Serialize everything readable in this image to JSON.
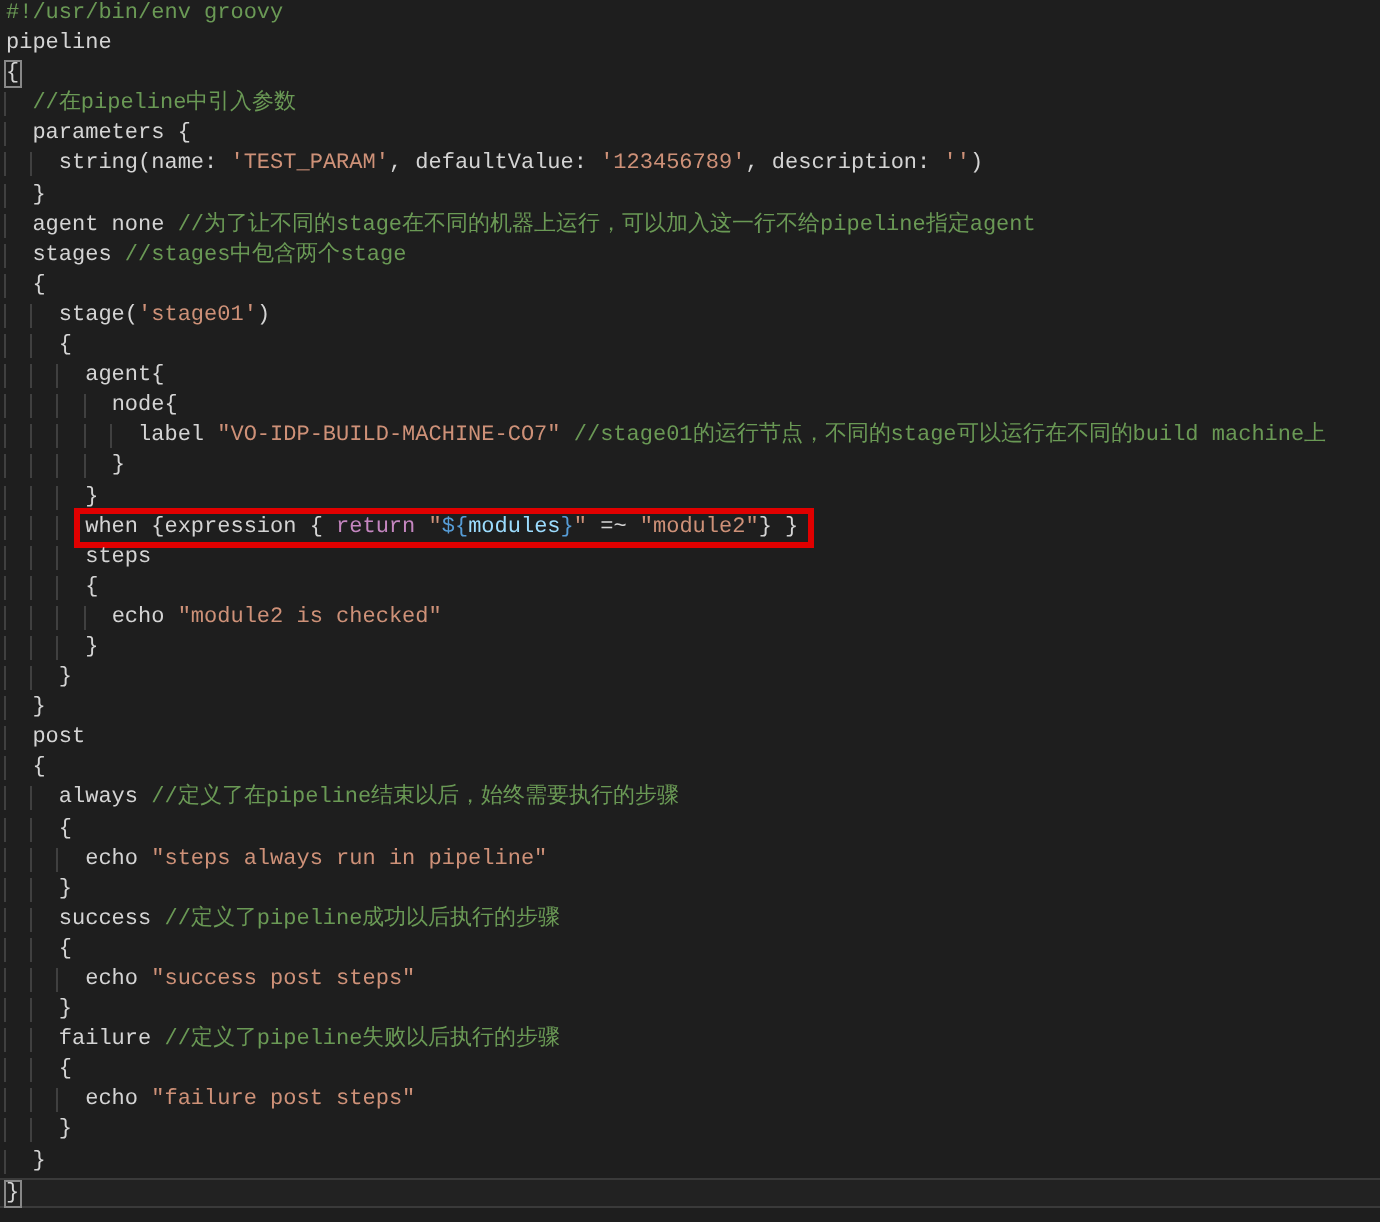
{
  "editor": {
    "lines": [
      {
        "tokens": [
          {
            "text": "#!/usr/bin/env groovy",
            "kind": "comment"
          }
        ],
        "highlighted": false,
        "current": false
      },
      {
        "tokens": [
          {
            "text": "pipeline",
            "kind": "plain"
          }
        ],
        "highlighted": false,
        "current": false
      },
      {
        "tokens": [
          {
            "text": "{",
            "kind": "bracket"
          }
        ],
        "highlighted": false,
        "current": false
      },
      {
        "tokens": [
          {
            "text": "  //在pipeline中引入参数",
            "kind": "comment"
          }
        ],
        "highlighted": false,
        "current": false
      },
      {
        "tokens": [
          {
            "text": "  parameters {",
            "kind": "plain"
          }
        ],
        "highlighted": false,
        "current": false
      },
      {
        "tokens": [
          {
            "text": "    string(name: ",
            "kind": "plain"
          },
          {
            "text": "'TEST_PARAM'",
            "kind": "string"
          },
          {
            "text": ", defaultValue: ",
            "kind": "plain"
          },
          {
            "text": "'123456789'",
            "kind": "string"
          },
          {
            "text": ", description: ",
            "kind": "plain"
          },
          {
            "text": "''",
            "kind": "string"
          },
          {
            "text": ")",
            "kind": "plain"
          }
        ],
        "highlighted": false,
        "current": false
      },
      {
        "tokens": [
          {
            "text": "  }",
            "kind": "plain"
          }
        ],
        "highlighted": false,
        "current": false
      },
      {
        "tokens": [
          {
            "text": "  agent none ",
            "kind": "plain"
          },
          {
            "text": "//为了让不同的stage在不同的机器上运行，可以加入这一行不给pipeline指定agent",
            "kind": "comment"
          }
        ],
        "highlighted": false,
        "current": false
      },
      {
        "tokens": [
          {
            "text": "  stages ",
            "kind": "plain"
          },
          {
            "text": "//stages中包含两个stage",
            "kind": "comment"
          }
        ],
        "highlighted": false,
        "current": false
      },
      {
        "tokens": [
          {
            "text": "  {",
            "kind": "plain"
          }
        ],
        "highlighted": false,
        "current": false
      },
      {
        "tokens": [
          {
            "text": "    stage(",
            "kind": "plain"
          },
          {
            "text": "'stage01'",
            "kind": "string"
          },
          {
            "text": ")",
            "kind": "plain"
          }
        ],
        "highlighted": false,
        "current": false
      },
      {
        "tokens": [
          {
            "text": "    {",
            "kind": "plain"
          }
        ],
        "highlighted": false,
        "current": false
      },
      {
        "tokens": [
          {
            "text": "      agent{",
            "kind": "plain"
          }
        ],
        "highlighted": false,
        "current": false
      },
      {
        "tokens": [
          {
            "text": "        node{",
            "kind": "plain"
          }
        ],
        "highlighted": false,
        "current": false
      },
      {
        "tokens": [
          {
            "text": "          label ",
            "kind": "plain"
          },
          {
            "text": "\"VO-IDP-BUILD-MACHINE-CO7\"",
            "kind": "string"
          },
          {
            "text": " //stage01的运行节点，不同的stage可以运行在不同的build machine上",
            "kind": "comment"
          }
        ],
        "highlighted": false,
        "current": false
      },
      {
        "tokens": [
          {
            "text": "        }",
            "kind": "plain"
          }
        ],
        "highlighted": false,
        "current": false
      },
      {
        "tokens": [
          {
            "text": "      }",
            "kind": "plain"
          }
        ],
        "highlighted": false,
        "current": false
      },
      {
        "tokens": [
          {
            "text": "      when {expression { ",
            "kind": "plain"
          },
          {
            "text": "return ",
            "kind": "keyword"
          },
          {
            "text": "\"",
            "kind": "string"
          },
          {
            "text": "${",
            "kind": "interp"
          },
          {
            "text": "modules",
            "kind": "variable"
          },
          {
            "text": "}",
            "kind": "interp"
          },
          {
            "text": "\"",
            "kind": "string"
          },
          {
            "text": " =~ ",
            "kind": "plain"
          },
          {
            "text": "\"module2\"",
            "kind": "string"
          },
          {
            "text": "} }",
            "kind": "plain"
          }
        ],
        "highlighted": true,
        "current": false
      },
      {
        "tokens": [
          {
            "text": "      steps",
            "kind": "plain"
          }
        ],
        "highlighted": false,
        "current": false
      },
      {
        "tokens": [
          {
            "text": "      {",
            "kind": "plain"
          }
        ],
        "highlighted": false,
        "current": false
      },
      {
        "tokens": [
          {
            "text": "        echo ",
            "kind": "plain"
          },
          {
            "text": "\"module2 is checked\"",
            "kind": "string"
          }
        ],
        "highlighted": false,
        "current": false
      },
      {
        "tokens": [
          {
            "text": "      }",
            "kind": "plain"
          }
        ],
        "highlighted": false,
        "current": false
      },
      {
        "tokens": [
          {
            "text": "    }",
            "kind": "plain"
          }
        ],
        "highlighted": false,
        "current": false
      },
      {
        "tokens": [
          {
            "text": "  }",
            "kind": "plain"
          }
        ],
        "highlighted": false,
        "current": false
      },
      {
        "tokens": [
          {
            "text": "  post",
            "kind": "plain"
          }
        ],
        "highlighted": false,
        "current": false
      },
      {
        "tokens": [
          {
            "text": "  {",
            "kind": "plain"
          }
        ],
        "highlighted": false,
        "current": false
      },
      {
        "tokens": [
          {
            "text": "    always ",
            "kind": "plain"
          },
          {
            "text": "//定义了在pipeline结束以后，始终需要执行的步骤",
            "kind": "comment"
          }
        ],
        "highlighted": false,
        "current": false
      },
      {
        "tokens": [
          {
            "text": "    {",
            "kind": "plain"
          }
        ],
        "highlighted": false,
        "current": false
      },
      {
        "tokens": [
          {
            "text": "      echo ",
            "kind": "plain"
          },
          {
            "text": "\"steps always run in pipeline\"",
            "kind": "string"
          }
        ],
        "highlighted": false,
        "current": false
      },
      {
        "tokens": [
          {
            "text": "    }",
            "kind": "plain"
          }
        ],
        "highlighted": false,
        "current": false
      },
      {
        "tokens": [
          {
            "text": "    success ",
            "kind": "plain"
          },
          {
            "text": "//定义了pipeline成功以后执行的步骤",
            "kind": "comment"
          }
        ],
        "highlighted": false,
        "current": false
      },
      {
        "tokens": [
          {
            "text": "    {",
            "kind": "plain"
          }
        ],
        "highlighted": false,
        "current": false
      },
      {
        "tokens": [
          {
            "text": "      echo ",
            "kind": "plain"
          },
          {
            "text": "\"success post steps\"",
            "kind": "string"
          }
        ],
        "highlighted": false,
        "current": false
      },
      {
        "tokens": [
          {
            "text": "    }",
            "kind": "plain"
          }
        ],
        "highlighted": false,
        "current": false
      },
      {
        "tokens": [
          {
            "text": "    failure ",
            "kind": "plain"
          },
          {
            "text": "//定义了pipeline失败以后执行的步骤",
            "kind": "comment"
          }
        ],
        "highlighted": false,
        "current": false
      },
      {
        "tokens": [
          {
            "text": "    {",
            "kind": "plain"
          }
        ],
        "highlighted": false,
        "current": false
      },
      {
        "tokens": [
          {
            "text": "      echo ",
            "kind": "plain"
          },
          {
            "text": "\"failure post steps\"",
            "kind": "string"
          }
        ],
        "highlighted": false,
        "current": false
      },
      {
        "tokens": [
          {
            "text": "    }",
            "kind": "plain"
          }
        ],
        "highlighted": false,
        "current": false
      },
      {
        "tokens": [
          {
            "text": "  }",
            "kind": "plain"
          }
        ],
        "highlighted": false,
        "current": false
      },
      {
        "tokens": [
          {
            "text": "}",
            "kind": "bracket"
          }
        ],
        "highlighted": false,
        "current": true
      }
    ]
  }
}
